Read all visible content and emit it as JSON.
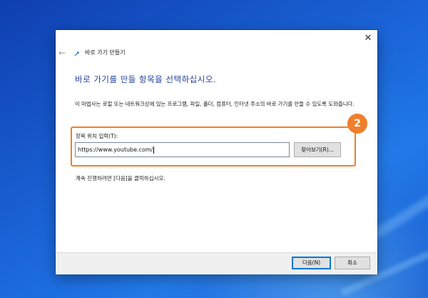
{
  "window": {
    "title": "바로 가기 만들기",
    "close_glyph": "✕",
    "back_glyph": "←",
    "icon": "shortcut-wizard-icon"
  },
  "main": {
    "heading": "바로 가기를 만들 항목을 선택하십시오.",
    "description": "이 마법사는 로컬 또는 네트워크상에 있는 프로그램, 파일, 폴더, 컴퓨터, 인터넷 주소의 바로 가기를 만들 수 있도록 도와줍니다.",
    "location_label": "항목 위치 입력(T):",
    "location_value": "https://www.youtube.com/",
    "browse_label": "찾아보기(R)...",
    "hint": "계속 진행하려면 [다음]을 클릭하십시오."
  },
  "annotation": {
    "badge": "2",
    "color": "#ef7f2a"
  },
  "footer": {
    "next_label": "다음(N)",
    "cancel_label": "취소"
  },
  "colors": {
    "heading": "#1f3f9a",
    "desktop": "#1556c6",
    "accent": "#0078d7"
  }
}
